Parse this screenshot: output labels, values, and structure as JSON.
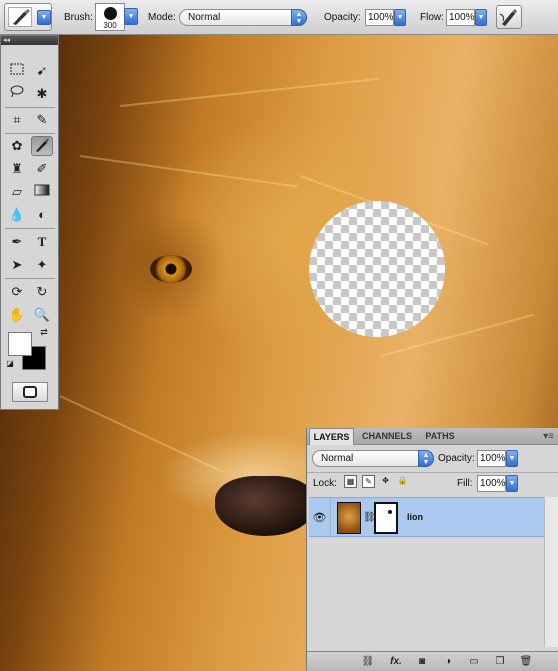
{
  "options_bar": {
    "brush_label": "Brush:",
    "brush_size": "300",
    "mode_label": "Mode:",
    "mode_value": "Normal",
    "opacity_label": "Opacity:",
    "opacity_value": "100%",
    "flow_label": "Flow:",
    "flow_value": "100%",
    "icons": [
      "brush-tool-preset-icon",
      "airbrush-icon"
    ]
  },
  "tools_panel": {
    "collapse_glyph": "◂◂",
    "tools": [
      "marquee-icon",
      "move-icon",
      "lasso-icon",
      "magic-wand-icon",
      "crop-icon",
      "eyedropper-icon",
      "healing-brush-icon",
      "brush-icon",
      "clone-stamp-icon",
      "history-brush-icon",
      "eraser-icon",
      "gradient-icon",
      "blur-icon",
      "dodge-icon",
      "pen-icon",
      "type-icon",
      "path-selection-icon",
      "shape-icon",
      "3d-rotate-icon",
      "3d-orbit-icon",
      "hand-icon",
      "zoom-icon"
    ],
    "type_tool_glyph": "T",
    "foreground_color": "#ffffff",
    "background_color": "#000000"
  },
  "layers_panel": {
    "tabs": [
      "LAYERS",
      "CHANNELS",
      "PATHS"
    ],
    "active_tab": "LAYERS",
    "blend_mode": "Normal",
    "opacity_label": "Opacity:",
    "opacity_value": "100%",
    "lock_label": "Lock:",
    "fill_label": "Fill:",
    "fill_value": "100%",
    "layers": [
      {
        "name": "lion",
        "visible": true,
        "selected": true,
        "has_mask": true
      }
    ],
    "footer_icons": [
      "link-layers-icon",
      "fx-icon",
      "add-mask-icon",
      "adjustment-layer-icon",
      "new-group-icon",
      "new-layer-icon",
      "trash-icon"
    ],
    "fx_label": "fx."
  },
  "colors": {
    "accent_blue": "#2f6fd3",
    "layer_selected": "#a9c9ee"
  }
}
